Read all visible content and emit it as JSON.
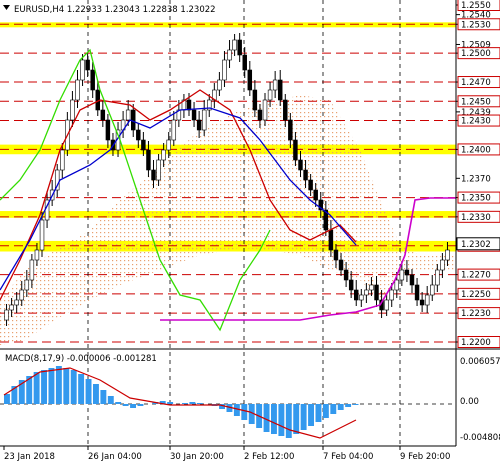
{
  "header": {
    "symbol_line": "EURUSD,H4  1.22933 1.23043 1.22838 1.23022"
  },
  "price_axis": {
    "labels": [
      "1.2550",
      "1.2540",
      "1.2530",
      "1.2509",
      "1.2500",
      "1.2470",
      "1.2450",
      "1.2439",
      "1.2430",
      "1.2400",
      "1.2370",
      "1.2350",
      "1.2330",
      "1.2300",
      "1.2270",
      "1.2250",
      "1.2230",
      "1.2200"
    ],
    "boxed": [
      "1.2550",
      "1.2530",
      "1.2500",
      "1.2470",
      "1.2450",
      "1.2430",
      "1.2400",
      "1.2350",
      "1.2330",
      "1.2300",
      "1.2270",
      "1.2250",
      "1.2230",
      "1.2200"
    ],
    "current_price": "1.2302"
  },
  "levels": {
    "red_dashed": [
      "1.2530",
      "1.2500",
      "1.2470",
      "1.2450",
      "1.2430",
      "1.2400",
      "1.2350",
      "1.2330",
      "1.2300",
      "1.2270",
      "1.2250",
      "1.2230",
      "1.2200"
    ],
    "yellow_bands": [
      [
        "1.2532",
        "1.2527"
      ],
      [
        "1.2405",
        "1.2395"
      ],
      [
        "1.2336",
        "1.2329"
      ],
      [
        "1.2305",
        "1.2294"
      ]
    ]
  },
  "macd": {
    "label": "MACD(8,17,9) -0.000006 -0.001281",
    "axis": [
      "0.006057",
      "0.00",
      "-0.004808"
    ],
    "zero_level": "0.00"
  },
  "time_axis": {
    "labels": [
      "23 Jan 2018",
      "26 Jan 04:00",
      "30 Jan 20:00",
      "2 Feb 12:00",
      "7 Feb 04:00",
      "9 Feb 20:00"
    ]
  },
  "colors": {
    "background": "#ffffff",
    "level_line": "#cc0000",
    "band": "#ffff00",
    "kijun": "#cc0000",
    "tenkan": "#0000cc",
    "chikou": "#33dd00",
    "bollinger": "#cc00cc",
    "cloud": "#e8a070",
    "macd_hist": "#3399ee",
    "signal": "#cc0000"
  }
}
